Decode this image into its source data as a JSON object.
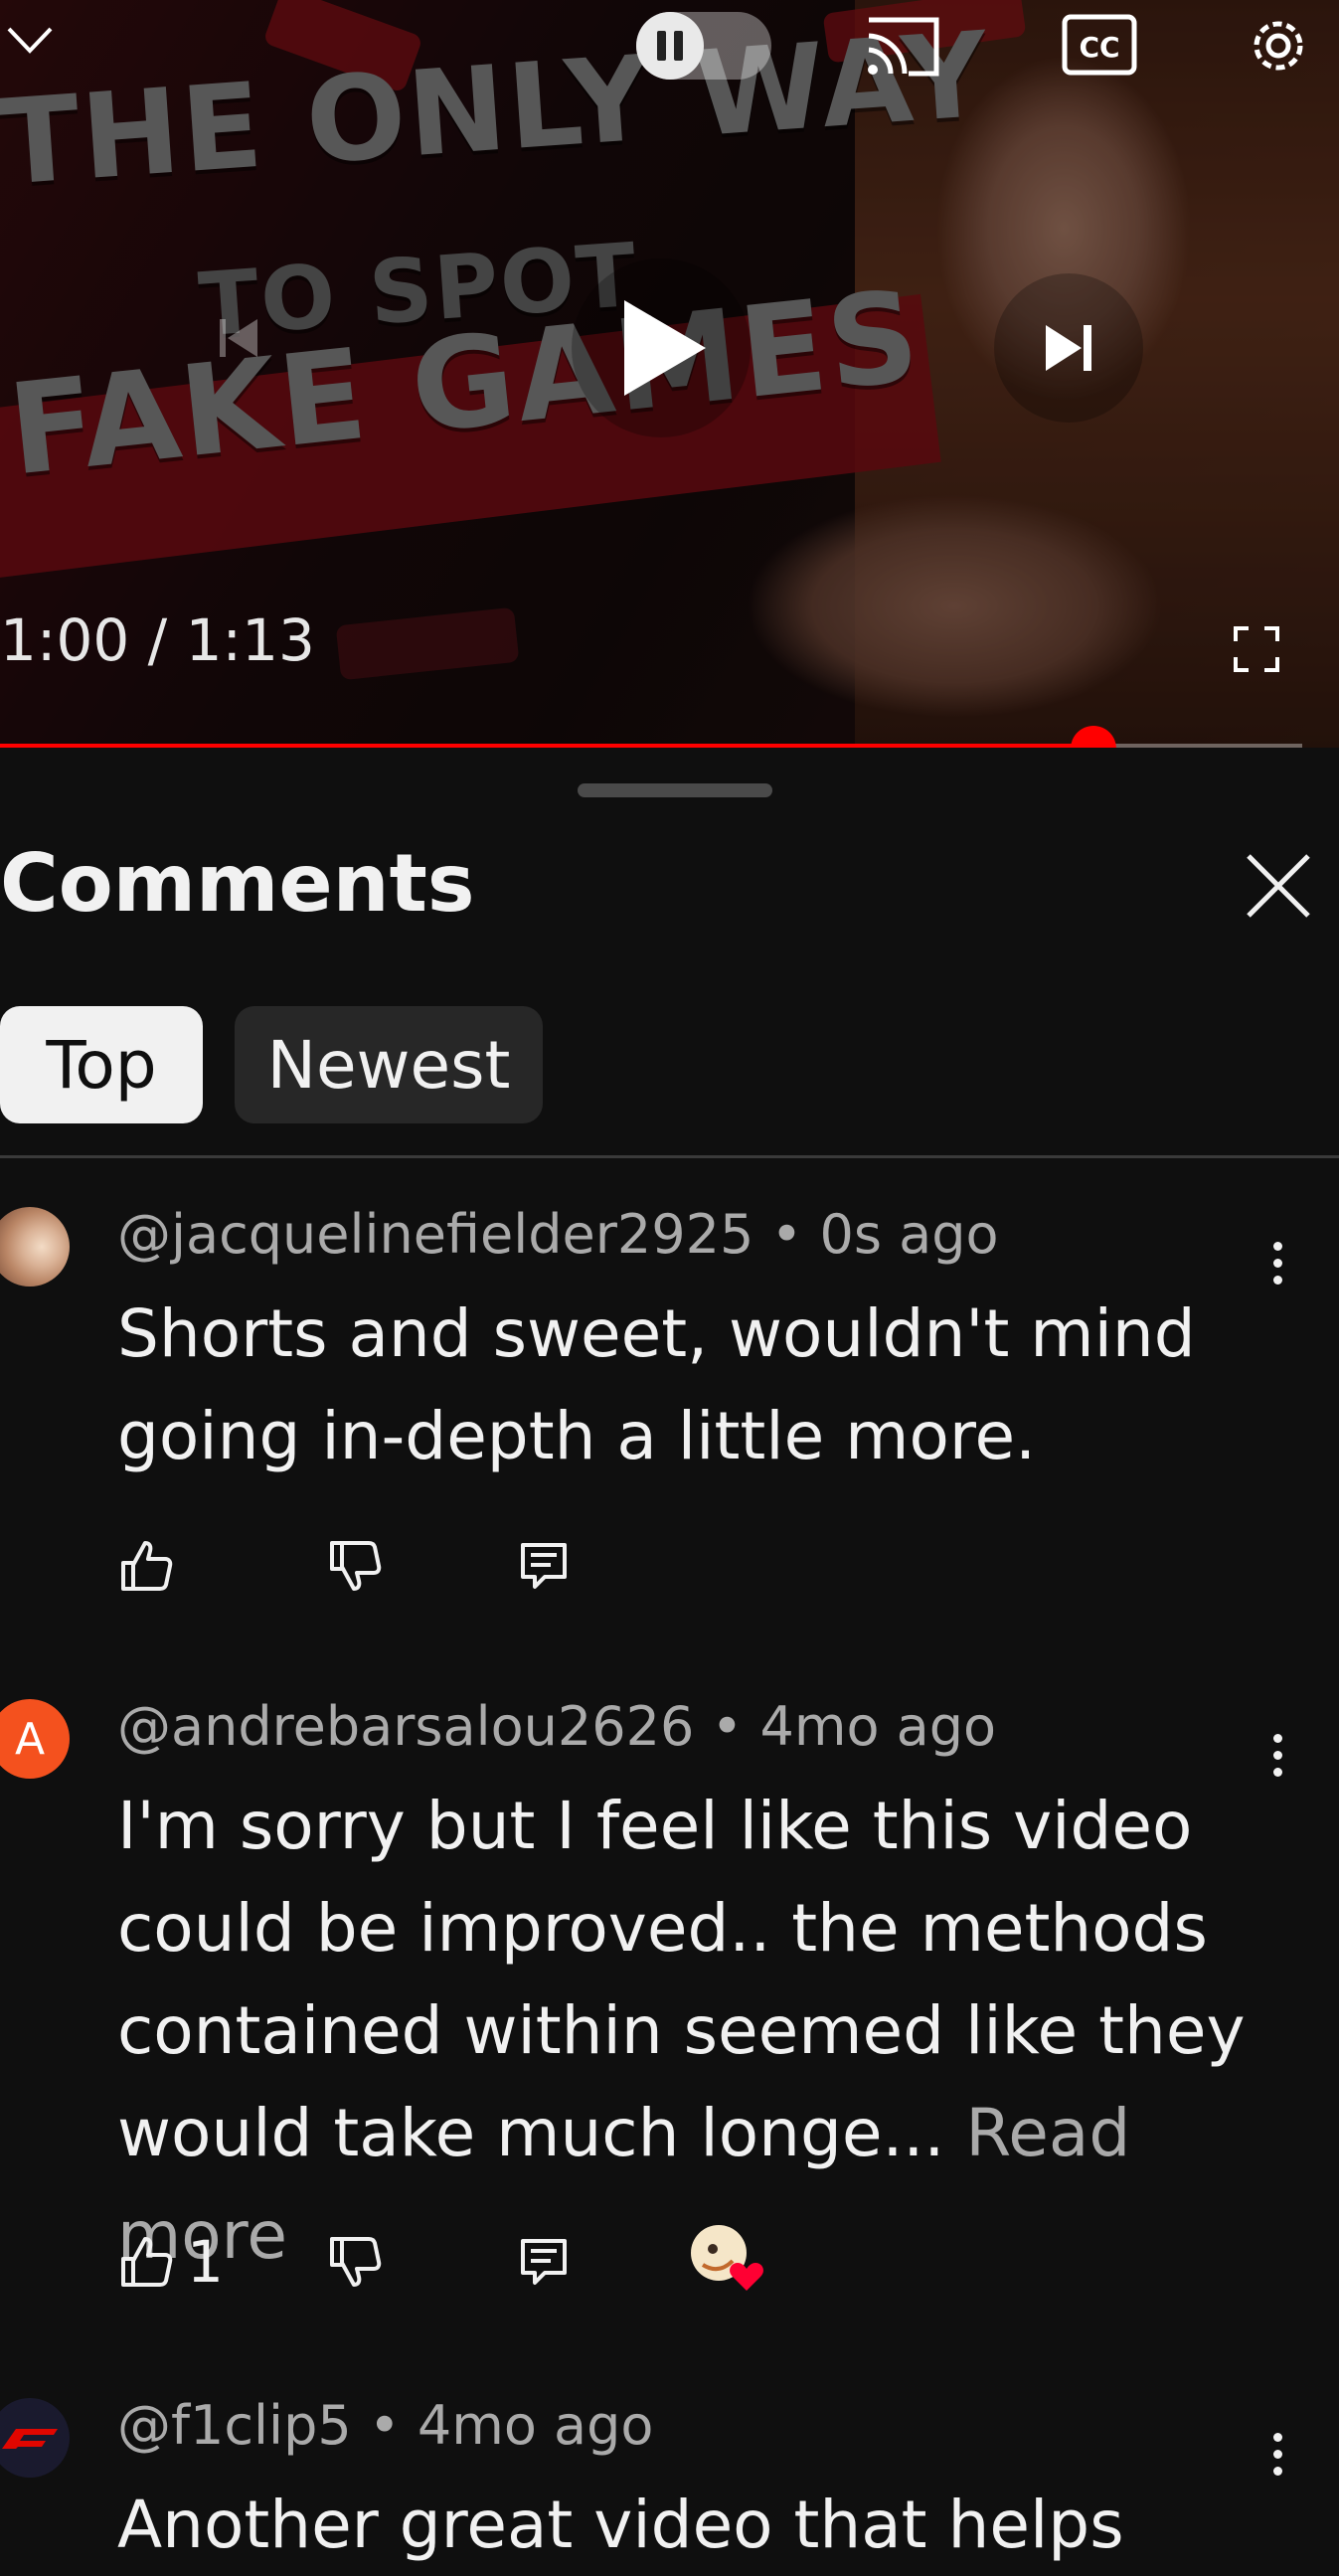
{
  "player": {
    "thumbnail_text": [
      "THE ONLY WAY",
      "TO SPOT",
      "FAKE GAMES"
    ],
    "time_current": "1:00",
    "time_total": "1:13",
    "time_display": "1:00 / 1:13",
    "progress_fraction": 0.84,
    "accent": "#ff0000"
  },
  "comments_sheet": {
    "title": "Comments",
    "chips": [
      "Top",
      "Newest"
    ],
    "selected_chip": "Top"
  },
  "comments": [
    {
      "author": "@jacquelinefielder2925",
      "age": "0s ago",
      "meta": "@jacquelinefielder2925 • 0s ago",
      "text": "Shorts and sweet, wouldn't mind going in-depth a little more.",
      "likes": "",
      "avatar_color": "#d8b49a"
    },
    {
      "author": "@andrebarsalou2626",
      "age": "4mo ago",
      "meta": "@andrebarsalou2626 • 4mo ago",
      "text": "I'm sorry but I feel like this video could be improved..  the methods contained within seemed like they would take much longe...",
      "read_more": "Read more",
      "likes": "1",
      "avatar_letter": "A",
      "avatar_color": "#f4511e"
    },
    {
      "author": "@f1clip5",
      "age": "4mo ago",
      "meta": "@f1clip5 • 4mo ago",
      "text": "Another great video that helps",
      "avatar_color": "#1a1a2e"
    }
  ]
}
